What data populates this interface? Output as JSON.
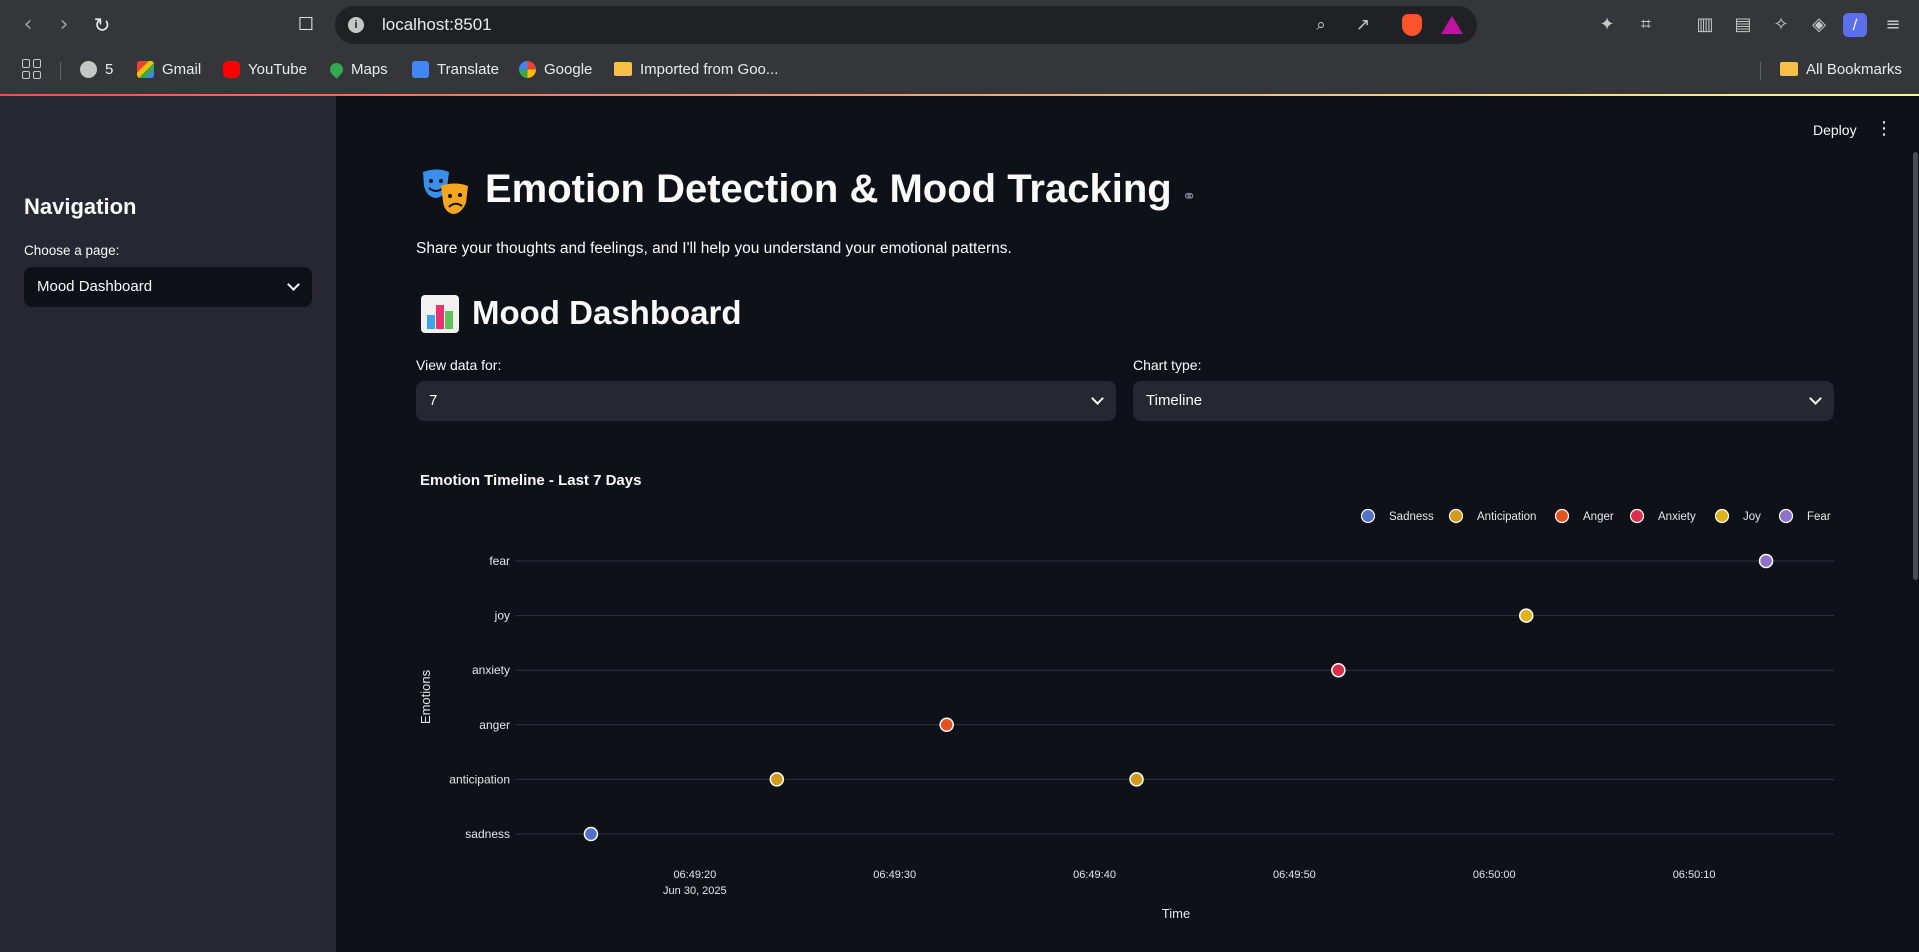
{
  "browser": {
    "url": "localhost:8501",
    "bookmarks": [
      {
        "label": "5",
        "icon": "globe-icon"
      },
      {
        "label": "Gmail",
        "icon": "gmail-icon"
      },
      {
        "label": "YouTube",
        "icon": "youtube-icon"
      },
      {
        "label": "Maps",
        "icon": "maps-icon"
      },
      {
        "label": "Translate",
        "icon": "translate-icon"
      },
      {
        "label": "Google",
        "icon": "google-icon"
      },
      {
        "label": "Imported from Goo...",
        "icon": "folder-icon"
      }
    ],
    "all_bookmarks": "All Bookmarks"
  },
  "app": {
    "deploy_label": "Deploy",
    "title": "Emotion Detection & Mood Tracking",
    "title_emoji": "🎭",
    "subtitle": "Share your thoughts and feelings, and I'll help you understand your emotional patterns.",
    "section_title": "Mood Dashboard",
    "section_emoji": "📊"
  },
  "sidebar": {
    "title": "Navigation",
    "select_label": "Choose a page:",
    "select_value": "Mood Dashboard"
  },
  "controls": {
    "view_label": "View data for:",
    "view_value": "7",
    "chart_label": "Chart type:",
    "chart_value": "Timeline"
  },
  "chart_data": {
    "type": "scatter",
    "title": "Emotion Timeline - Last 7 Days",
    "xlabel": "Time",
    "ylabel": "Emotions",
    "x_ticks": [
      "06:49:20",
      "06:49:30",
      "06:49:40",
      "06:49:50",
      "06:50:00",
      "06:50:10"
    ],
    "x_date_label": "Jun 30, 2025",
    "x_range": [
      "06:49:11",
      "06:50:17"
    ],
    "y_categories": [
      "sadness",
      "anticipation",
      "anger",
      "anxiety",
      "joy",
      "fear"
    ],
    "legend_position": "top-right",
    "grid": true,
    "series": [
      {
        "name": "Sadness",
        "color": "#5470c6",
        "points": [
          {
            "x": "06:49:14.8",
            "y": "sadness"
          }
        ]
      },
      {
        "name": "Anticipation",
        "color": "#d09a1f",
        "points": [
          {
            "x": "06:49:24.1",
            "y": "anticipation"
          },
          {
            "x": "06:49:42.1",
            "y": "anticipation"
          }
        ]
      },
      {
        "name": "Anger",
        "color": "#e2531f",
        "points": [
          {
            "x": "06:49:32.6",
            "y": "anger"
          }
        ]
      },
      {
        "name": "Anxiety",
        "color": "#dc2e4c",
        "points": [
          {
            "x": "06:49:52.2",
            "y": "anxiety"
          }
        ]
      },
      {
        "name": "Joy",
        "color": "#e0b21e",
        "points": [
          {
            "x": "06:50:01.6",
            "y": "joy"
          }
        ]
      },
      {
        "name": "Fear",
        "color": "#8d72c9",
        "points": [
          {
            "x": "06:50:13.6",
            "y": "fear"
          }
        ]
      }
    ]
  }
}
